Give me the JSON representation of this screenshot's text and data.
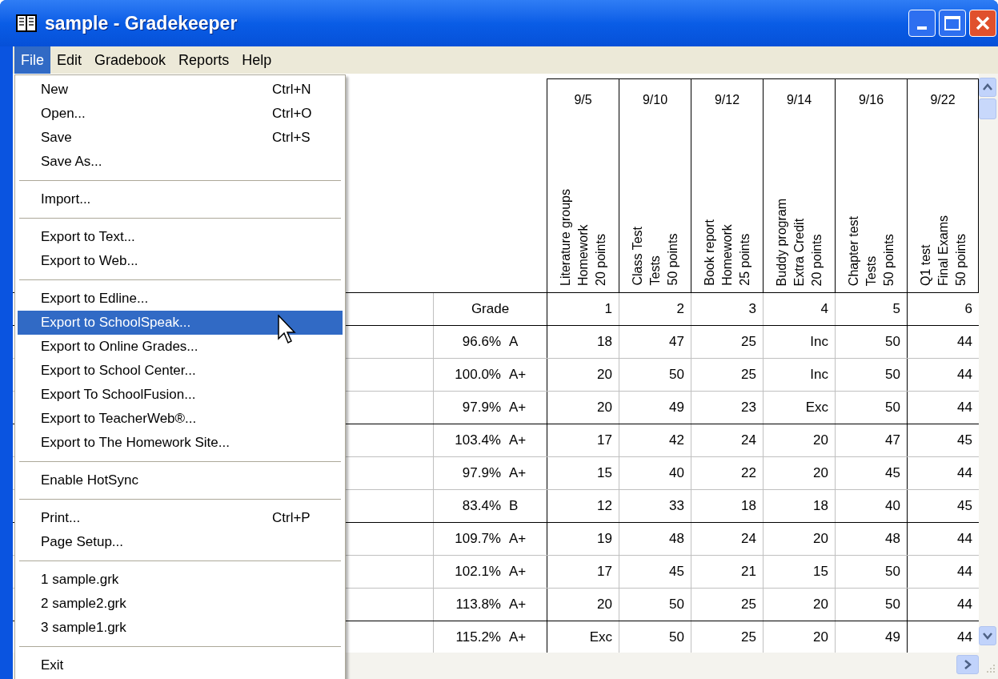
{
  "window": {
    "title": "sample - Gradekeeper"
  },
  "menubar": [
    {
      "label": "File",
      "selected": true
    },
    {
      "label": "Edit",
      "selected": false
    },
    {
      "label": "Gradebook",
      "selected": false
    },
    {
      "label": "Reports",
      "selected": false
    },
    {
      "label": "Help",
      "selected": false
    }
  ],
  "file_menu": {
    "groups": [
      [
        {
          "label": "New",
          "shortcut": "Ctrl+N",
          "selected": false
        },
        {
          "label": "Open...",
          "shortcut": "Ctrl+O",
          "selected": false
        },
        {
          "label": "Save",
          "shortcut": "Ctrl+S",
          "selected": false
        },
        {
          "label": "Save As...",
          "selected": false
        }
      ],
      [
        {
          "label": "Import...",
          "selected": false
        }
      ],
      [
        {
          "label": "Export to Text...",
          "selected": false
        },
        {
          "label": "Export to Web...",
          "selected": false
        }
      ],
      [
        {
          "label": "Export to Edline...",
          "selected": false
        },
        {
          "label": "Export to SchoolSpeak...",
          "selected": true
        },
        {
          "label": "Export to Online Grades...",
          "selected": false
        },
        {
          "label": "Export to School Center...",
          "selected": false
        },
        {
          "label": "Export To SchoolFusion...",
          "selected": false
        },
        {
          "label": "Export to TeacherWeb®...",
          "selected": false
        },
        {
          "label": "Export to The Homework Site...",
          "selected": false
        }
      ],
      [
        {
          "label": "Enable HotSync",
          "selected": false
        }
      ],
      [
        {
          "label": "Print...",
          "shortcut": "Ctrl+P",
          "selected": false
        },
        {
          "label": "Page Setup...",
          "selected": false
        }
      ],
      [
        {
          "label": "1 sample.grk",
          "selected": false
        },
        {
          "label": "2 sample2.grk",
          "selected": false
        },
        {
          "label": "3 sample1.grk",
          "selected": false
        }
      ],
      [
        {
          "label": "Exit",
          "selected": false
        }
      ]
    ]
  },
  "table": {
    "grade_header": "Grade",
    "columns": [
      {
        "date": "9/5",
        "title": "Literature groups",
        "category": "Homework",
        "points": "20 points",
        "number": "1"
      },
      {
        "date": "9/10",
        "title": "Class Test",
        "category": "Tests",
        "points": "50 points",
        "number": "2"
      },
      {
        "date": "9/12",
        "title": "Book report",
        "category": "Homework",
        "points": "25 points",
        "number": "3"
      },
      {
        "date": "9/14",
        "title": "Buddy program",
        "category": "Extra Credit",
        "points": "20 points",
        "number": "4"
      },
      {
        "date": "9/16",
        "title": "Chapter test",
        "category": "Tests",
        "points": "50 points",
        "number": "5"
      },
      {
        "date": "9/22",
        "title": "Q1 test",
        "category": "Final Exams",
        "points": "50 points",
        "number": "6"
      }
    ],
    "rows": [
      {
        "percent": "96.6%",
        "letter": "A",
        "scores": [
          "18",
          "47",
          "25",
          "Inc",
          "50",
          "44"
        ]
      },
      {
        "percent": "100.0%",
        "letter": "A+",
        "scores": [
          "20",
          "50",
          "25",
          "Inc",
          "50",
          "44"
        ]
      },
      {
        "percent": "97.9%",
        "letter": "A+",
        "scores": [
          "20",
          "49",
          "23",
          "Exc",
          "50",
          "44"
        ]
      },
      {
        "percent": "103.4%",
        "letter": "A+",
        "scores": [
          "17",
          "42",
          "24",
          "20",
          "47",
          "45"
        ]
      },
      {
        "percent": "97.9%",
        "letter": "A+",
        "scores": [
          "15",
          "40",
          "22",
          "20",
          "45",
          "44"
        ]
      },
      {
        "percent": "83.4%",
        "letter": "B",
        "scores": [
          "12",
          "33",
          "18",
          "18",
          "40",
          "45"
        ]
      },
      {
        "percent": "109.7%",
        "letter": "A+",
        "scores": [
          "19",
          "48",
          "24",
          "20",
          "48",
          "44"
        ]
      },
      {
        "percent": "102.1%",
        "letter": "A+",
        "scores": [
          "17",
          "45",
          "21",
          "15",
          "50",
          "44"
        ]
      },
      {
        "percent": "113.8%",
        "letter": "A+",
        "scores": [
          "20",
          "50",
          "25",
          "20",
          "50",
          "44"
        ]
      },
      {
        "percent": "115.2%",
        "letter": "A+",
        "scores": [
          "Exc",
          "50",
          "25",
          "20",
          "49",
          "44"
        ]
      }
    ]
  }
}
